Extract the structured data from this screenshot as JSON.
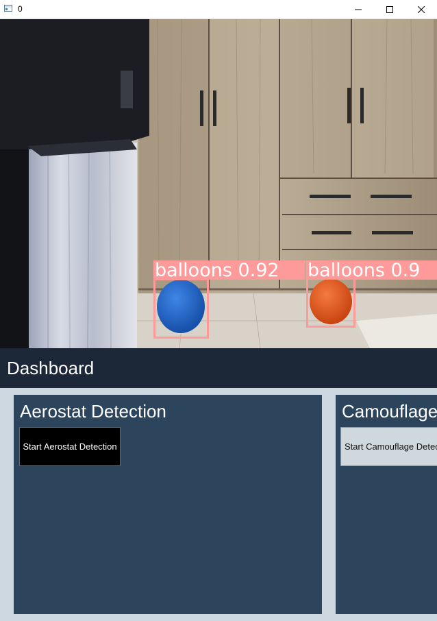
{
  "window": {
    "title": "0",
    "controls": [
      "minimize-icon",
      "maximize-icon",
      "close-icon"
    ]
  },
  "camera": {
    "detections": [
      {
        "label": "balloons 0.92",
        "class": "balloons",
        "confidence": 0.92,
        "object_color": "#1f63c7"
      },
      {
        "label": "balloons 0.9",
        "class": "balloons",
        "confidence": 0.9,
        "object_color": "#e8541e"
      }
    ],
    "box_color": "#ff9a9a"
  },
  "dashboard": {
    "title": "Dashboard"
  },
  "panels": [
    {
      "title": "Aerostat Detection",
      "button_label": "Start Aerostat Detection"
    },
    {
      "title": "Camouflage",
      "button_label": "Start Camouflage Detec"
    }
  ],
  "colors": {
    "header_bg": "#1c2838",
    "panel_bg": "#2c455d",
    "page_bg": "#cdd8e0"
  }
}
